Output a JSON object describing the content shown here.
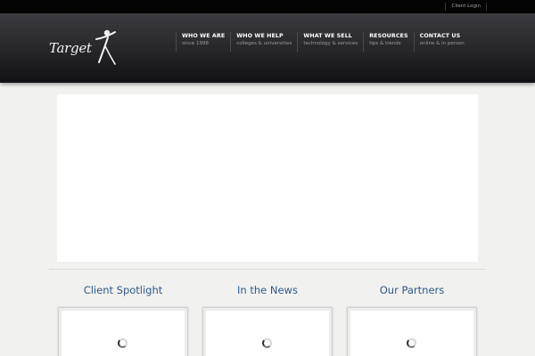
{
  "topbar": {
    "client_login": "Client Login"
  },
  "logo": {
    "text": "Target",
    "icon": "figure-x-icon"
  },
  "nav": [
    {
      "title": "WHO WE ARE",
      "sub": "since 1998"
    },
    {
      "title": "WHO WE HELP",
      "sub": "colleges & universities"
    },
    {
      "title": "WHAT WE SELL",
      "sub": "technology & services"
    },
    {
      "title": "RESOURCES",
      "sub": "tips & trends"
    },
    {
      "title": "CONTACT US",
      "sub": "online & in person"
    }
  ],
  "columns": [
    {
      "title": "Client Spotlight"
    },
    {
      "title": "In the News"
    },
    {
      "title": "Our Partners"
    }
  ],
  "colors": {
    "heading": "#2e5a8a",
    "header_dark": "#2a2a2d",
    "page_bg": "#f1f1ef"
  }
}
